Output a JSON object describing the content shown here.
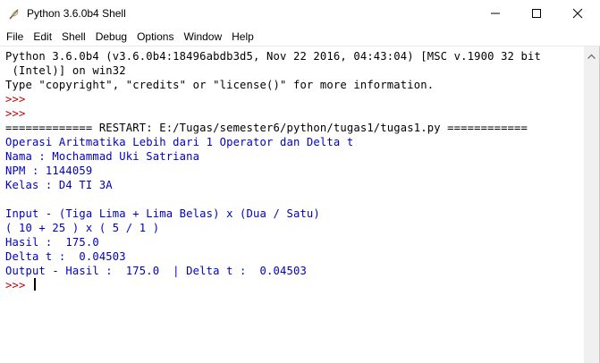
{
  "window": {
    "title": "Python 3.6.0b4 Shell"
  },
  "menu": [
    "File",
    "Edit",
    "Shell",
    "Debug",
    "Options",
    "Window",
    "Help"
  ],
  "shell": {
    "lines": [
      {
        "text": "Python 3.6.0b4 (v3.6.0b4:18496abdb3d5, Nov 22 2016, 04:43:04) [MSC v.1900 32 bit",
        "color": "black"
      },
      {
        "text": " (Intel)] on win32",
        "color": "black"
      },
      {
        "text": "Type \"copyright\", \"credits\" or \"license()\" for more information.",
        "color": "black"
      },
      {
        "text": ">>> ",
        "color": "red"
      },
      {
        "text": ">>> ",
        "color": "red"
      },
      {
        "text": "============= RESTART: E:/Tugas/semester6/python/tugas1/tugas1.py ============",
        "color": "black"
      },
      {
        "text": "Operasi Aritmatika Lebih dari 1 Operator dan Delta t",
        "color": "blue"
      },
      {
        "text": "Nama : Mochammad Uki Satriana",
        "color": "blue"
      },
      {
        "text": "NPM : 1144059",
        "color": "blue"
      },
      {
        "text": "Kelas : D4 TI 3A",
        "color": "blue"
      },
      {
        "text": "",
        "color": "blue"
      },
      {
        "text": "Input - (Tiga Lima + Lima Belas) x (Dua / Satu)",
        "color": "blue"
      },
      {
        "text": "( 10 + 25 ) x ( 5 / 1 )",
        "color": "blue"
      },
      {
        "text": "Hasil :  175.0",
        "color": "blue"
      },
      {
        "text": "Delta t :  0.04503",
        "color": "blue"
      },
      {
        "text": "Output - Hasil :  175.0  | Delta t :  0.04503",
        "color": "blue"
      }
    ],
    "prompt": ">>> "
  },
  "colors": {
    "black": "#000000",
    "red": "#c00000",
    "blue": "#0000c0"
  },
  "icons": {
    "app": "python-feather-icon",
    "minimize": "minimize-icon",
    "maximize": "maximize-icon",
    "close": "close-icon",
    "scroll_up": "chevron-up-icon"
  }
}
